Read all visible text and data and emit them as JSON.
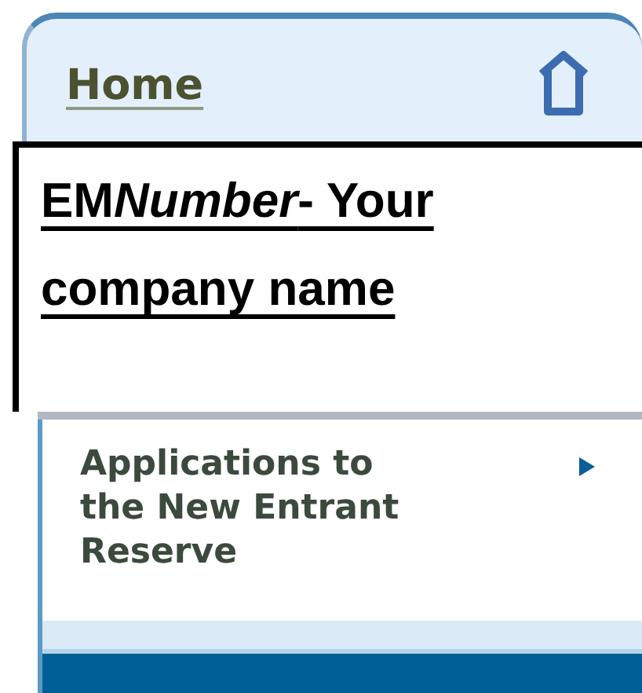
{
  "header": {
    "home_link": "Home"
  },
  "overlay": {
    "company_link": [
      {
        "text": "EM",
        "italic": false
      },
      {
        "text": "Number",
        "italic": true
      },
      {
        "text": "- Your company name",
        "italic": false
      }
    ]
  },
  "menu": {
    "items": [
      {
        "label": "Applications to the New Entrant Reserve"
      }
    ]
  }
}
